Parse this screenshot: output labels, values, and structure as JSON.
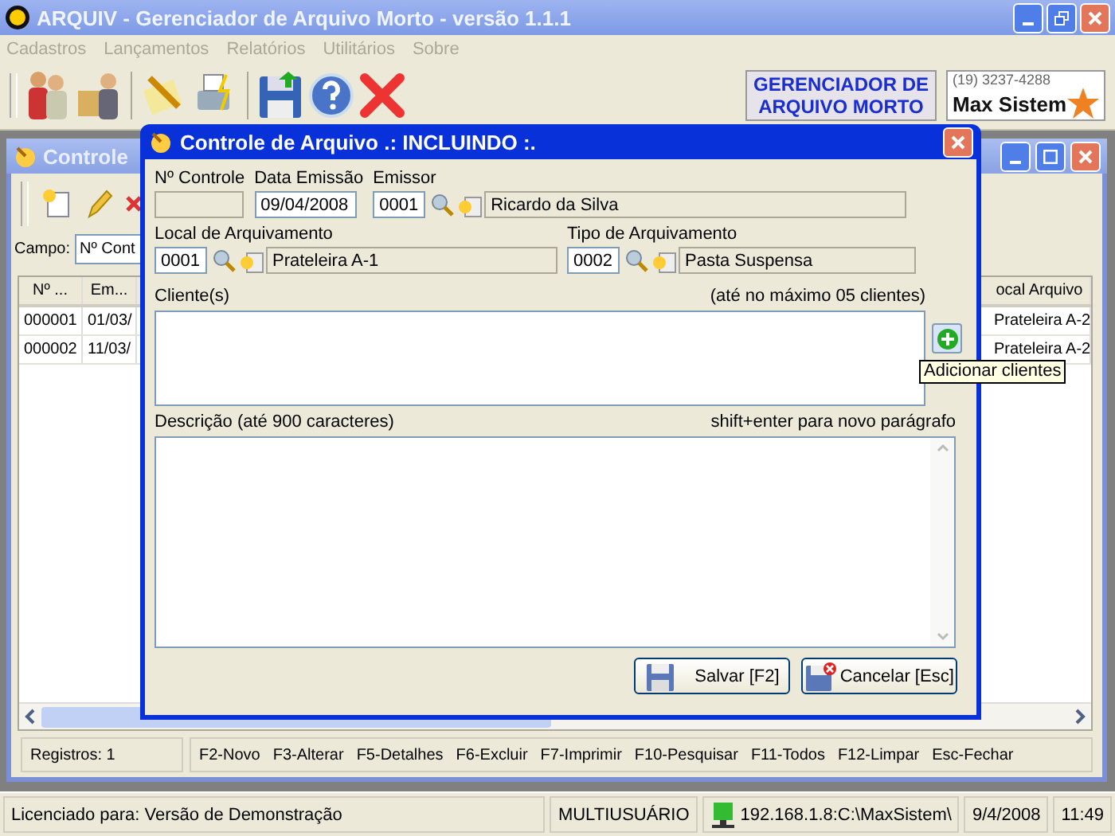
{
  "window": {
    "title": "ARQUIV - Gerenciador de Arquivo Morto - versão 1.1.1"
  },
  "menu": [
    {
      "label": "Cadastros",
      "disabled": true
    },
    {
      "label": "Lançamentos",
      "disabled": true
    },
    {
      "label": "Relatórios",
      "disabled": true
    },
    {
      "label": "Utilitários",
      "disabled": true
    },
    {
      "label": "Sobre",
      "disabled": true
    }
  ],
  "banner": {
    "line_1": "GERENCIADOR DE",
    "line_2": "ARQUIVO MORTO"
  },
  "logo": {
    "phone": "(19) 3237-4288",
    "name": "Max Sistem"
  },
  "child_window": {
    "title": "Controle",
    "campo_label": "Campo:",
    "campo_value": "Nº Cont",
    "columns": [
      "Nº ...",
      "Em...",
      "ocal Arquivo"
    ],
    "rows": [
      [
        "000001",
        "01/03/",
        "Prateleira A-2"
      ],
      [
        "000002",
        "11/03/",
        "Prateleira A-2"
      ]
    ],
    "record_count": "Registros: 1",
    "shortcuts": [
      "F2-Novo",
      "F3-Alterar",
      "F5-Detalhes",
      "F6-Excluir",
      "F7-Imprimir",
      "F10-Pesquisar",
      "F11-Todos",
      "F12-Limpar",
      "Esc-Fechar"
    ]
  },
  "dialog": {
    "title": "Controle de Arquivo  .: INCLUINDO :.",
    "controle_label": "Nº Controle",
    "data_label": "Data Emissão",
    "data_value": "09/04/2008",
    "emissor_label": "Emissor",
    "emissor_code": "0001",
    "emissor_name": "Ricardo da Silva",
    "local_label": "Local de Arquivamento",
    "local_code": "0001",
    "local_name": "Prateleira A-1",
    "tipo_label": "Tipo de Arquivamento",
    "tipo_code": "0002",
    "tipo_name": "Pasta Suspensa",
    "clientes_label": "Cliente(s)",
    "clientes_hint": "(até no máximo 05 clientes)",
    "tooltip": "Adicionar clientes",
    "descricao_label": "Descrição (até 900 caracteres)",
    "descricao_hint": "shift+enter para novo parágrafo",
    "buttons": [
      {
        "label": "Salvar [F2]",
        "kind": "save"
      },
      {
        "label": "Cancelar [Esc]",
        "kind": "cancel"
      }
    ]
  },
  "status_bar": [
    {
      "text": "Licenciado para: Versão de Demonstração",
      "kind": "text"
    },
    {
      "text": "MULTIUSUÁRIO",
      "kind": "text"
    },
    {
      "text": "192.168.1.8:C:\\MaxSistem\\",
      "kind": "network"
    },
    {
      "text": "9/4/2008",
      "kind": "text"
    },
    {
      "text": "11:49",
      "kind": "text"
    }
  ]
}
